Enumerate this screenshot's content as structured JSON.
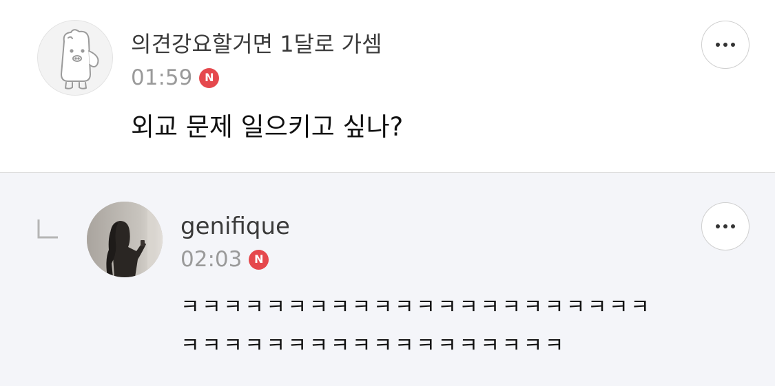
{
  "comment": {
    "author": "의견강요할거면 1달로 가셈",
    "time": "01:59",
    "badge": "N",
    "text": "외교 문제 일으키고 싶나?",
    "avatar_icon": "bear-mascot-icon",
    "more_icon": "more-horizontal-icon"
  },
  "reply": {
    "author": "genifique",
    "time": "02:03",
    "badge": "N",
    "text": "ㅋㅋㅋㅋㅋㅋㅋㅋㅋㅋㅋㅋㅋㅋㅋㅋㅋㅋㅋㅋㅋㅋ\nㅋㅋㅋㅋㅋㅋㅋㅋㅋㅋㅋㅋㅋㅋㅋㅋㅋㅋ",
    "avatar_icon": "profile-photo",
    "reply_icon": "reply-indicator-icon",
    "more_icon": "more-horizontal-icon"
  },
  "colors": {
    "badge": "#e5484d",
    "reply_background": "#f4f5f9",
    "meta_text": "#9a9a9a"
  }
}
